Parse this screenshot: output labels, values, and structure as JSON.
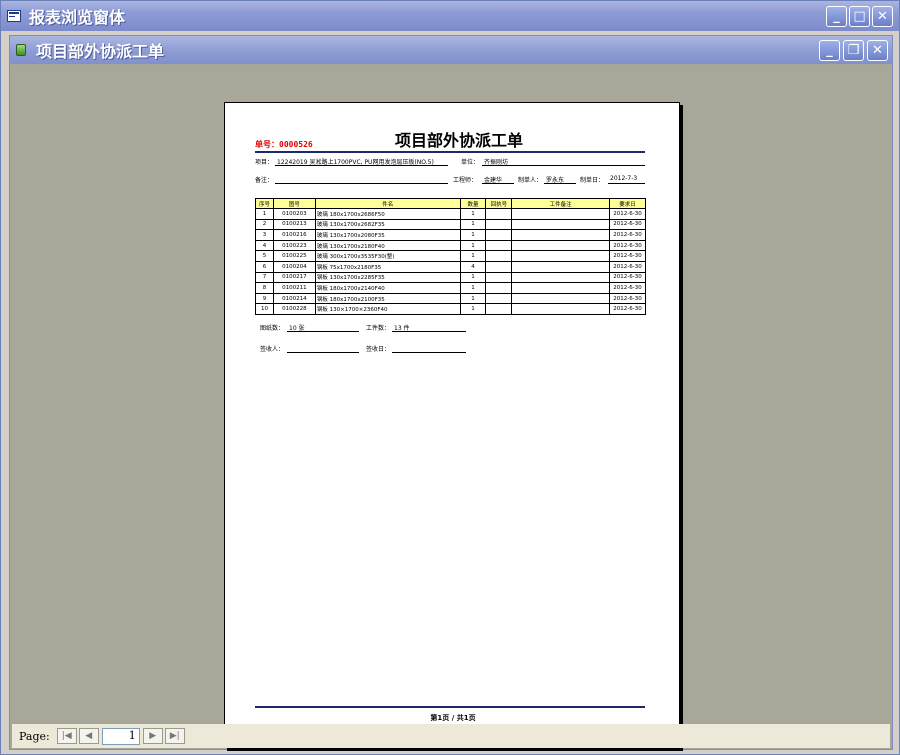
{
  "window": {
    "title": "报表浏览窗体"
  },
  "inner_window": {
    "title": "项目部外协派工单"
  },
  "report": {
    "number_label": "单号：",
    "number": "0000526",
    "title": "项目部外协派工单",
    "project_label": "项目：",
    "project_value": "12242019 吴淞路上1700PVC, PU网用发泡层压板(NO.5)",
    "unit_label": "单位：",
    "unit_value": "齐振刚坊",
    "remark_label": "备注：",
    "remark_value": "",
    "engineer_label": "工程师：",
    "engineer_value": "金建华",
    "maker_label": "制单人：",
    "maker_value": "罗永东",
    "date_label": "制单日：",
    "date_value": "2012-7-3",
    "table_headers": [
      "序号",
      "图号",
      "件名",
      "数量",
      "回执号",
      "工件备注",
      "要求日"
    ],
    "rows": [
      [
        "1",
        "0100203",
        "玻璃 180x1700x2686F50",
        "1",
        "",
        "",
        "2012-6-30"
      ],
      [
        "2",
        "0100213",
        "玻璃 130x1700x2682F35",
        "1",
        "",
        "",
        "2012-6-30"
      ],
      [
        "3",
        "0100216",
        "玻璃 130x1700x2080F35",
        "1",
        "",
        "",
        "2012-6-30"
      ],
      [
        "4",
        "0100223",
        "玻璃 130x1700x2180F40",
        "1",
        "",
        "",
        "2012-6-30"
      ],
      [
        "5",
        "0100225",
        "玻璃 300x1700x3535F30(整)",
        "1",
        "",
        "",
        "2012-6-30"
      ],
      [
        "6",
        "0100204",
        "钢板 75x1700x2180F35",
        "4",
        "",
        "",
        "2012-6-30"
      ],
      [
        "7",
        "0100217",
        "钢板 130x1700x2285F35",
        "1",
        "",
        "",
        "2012-6-30"
      ],
      [
        "8",
        "0100211",
        "钢板 180x1700x2140F40",
        "1",
        "",
        "",
        "2012-6-30"
      ],
      [
        "9",
        "0100214",
        "钢板 180x1700x2100F35",
        "1",
        "",
        "",
        "2012-6-30"
      ],
      [
        "10",
        "0100228",
        "钢板 130×1700×2360F40",
        "1",
        "",
        "",
        "2012-6-30"
      ]
    ],
    "drawings_label": "图纸数：",
    "drawings_value": "10 张",
    "pieces_label": "工件数：",
    "pieces_value": "13 件",
    "receiver_label": "签收人：",
    "receiver_value": "",
    "receive_date_label": "签收日：",
    "receive_date_value": "",
    "footer": "第1页 / 共1页"
  },
  "navigation": {
    "page_label": "Page:",
    "current_page": "1"
  }
}
